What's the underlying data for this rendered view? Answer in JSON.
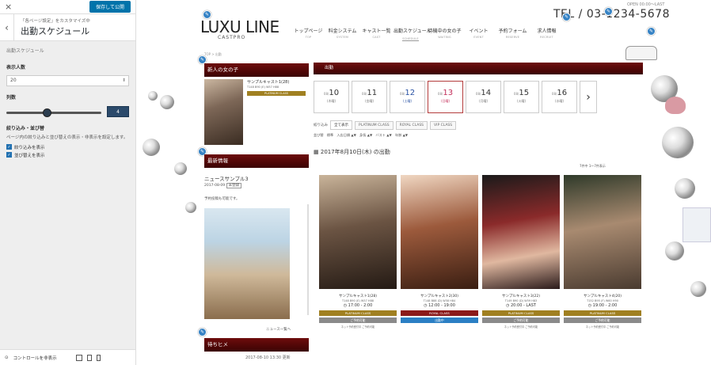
{
  "customizer": {
    "close": "×",
    "publish": "保存して公開",
    "back": "‹",
    "subtitle": "「各ページ設定」をカスタマイズ中",
    "title": "出勤スケジュール",
    "section_label": "出勤スケジュール",
    "count_label": "表示人数",
    "count_value": "20",
    "cols_label": "列数",
    "cols_value": "4",
    "filter_label": "絞り込み・並び替",
    "filter_desc": "ページ内の絞り込みと並び替えの表示・非表示を設定します。",
    "check1": "絞り込みを表示",
    "check2": "並び替えを表示",
    "footer": "コントロールを非表示"
  },
  "site": {
    "logo": "LUXU LINE",
    "logo_sub": "CASTPRO",
    "tel": "TEL / 03-1234-5678",
    "tel_small": "OPEN 00:00〜LAST",
    "nav": [
      {
        "jp": "トップページ",
        "en": "TOP"
      },
      {
        "jp": "料金システム",
        "en": "SYSTEM"
      },
      {
        "jp": "キャスト一覧",
        "en": "CAST"
      },
      {
        "jp": "出勤スケジュール",
        "en": "SCHEDULE"
      },
      {
        "jp": "待機中の女の子",
        "en": "WAITING"
      },
      {
        "jp": "イベント",
        "en": "EVENT"
      },
      {
        "jp": "予約フォーム",
        "en": "RESERVE"
      },
      {
        "jp": "求人情報",
        "en": "RECRUIT"
      }
    ],
    "breadcrumb": "TOP > 出勤",
    "newgirl_head": "新人の女の子",
    "newgirl_name": "サンプルキャスト1(28)",
    "newgirl_spec": "T148 B90 (E) W57 H88",
    "newgirl_badge": "PLATINUM CLASS",
    "news_head": "最新情報",
    "news_title": "ニュースサンプル3",
    "news_date": "2017-08-09",
    "news_tag": "未登録",
    "news_text": "予約投稿も可能です。",
    "news_more": "ニュース一覧へ",
    "diary_head": "待ちヒメ",
    "diary_date": "2017-08-10 13:30 更新"
  },
  "schedule": {
    "head": "出勤",
    "days": [
      {
        "m": "08/",
        "d": "10",
        "w": "(木曜)",
        "today": false
      },
      {
        "m": "08/",
        "d": "11",
        "w": "(金曜)",
        "today": false
      },
      {
        "m": "08/",
        "d": "12",
        "w": "(土曜)",
        "today": false
      },
      {
        "m": "08/",
        "d": "13",
        "w": "(日曜)",
        "today": true
      },
      {
        "m": "08/",
        "d": "14",
        "w": "(月曜)",
        "today": false
      },
      {
        "m": "08/",
        "d": "15",
        "w": "(火曜)",
        "today": false
      },
      {
        "m": "08/",
        "d": "16",
        "w": "(水曜)",
        "today": false
      }
    ],
    "next": "›",
    "filter_label": "絞り込み",
    "filters": [
      "全て表示",
      "PLATINUM CLASS",
      "ROYAL CLASS",
      "VIP CLASS"
    ],
    "sort_text": "並び替　標準　入店日順 ▲▼　身長 ▲▼　バスト ▲▼　年齢 ▲▼",
    "date": "2017年8月10日(木) の出勤",
    "count": "7件中 1〜7件表示",
    "cards": [
      {
        "name": "サンプルキャスト1(28)",
        "spec": "T148 B90 (E) W57 H88",
        "time": "17:00 - 2:00",
        "cls": "PLATINUM CLASS",
        "cls_color": "#a08021",
        "res": "ご予約可能",
        "note": "ネット予約受付中 ご予約可能"
      },
      {
        "name": "サンプルキャスト2(30)",
        "spec": "T148 B88 (D) W58 H84",
        "time": "12:00 - 19:00",
        "cls": "ROYAL CLASS",
        "cls_color": "#8b1a1a",
        "res": "出勤中",
        "note": ""
      },
      {
        "name": "サンプルキャスト3(22)",
        "spec": "T149 B90 (D) W59 H83",
        "time": "20:00 - LAST",
        "cls": "PLATINUM CLASS",
        "cls_color": "#a08021",
        "res": "ご予約可能",
        "note": "ネット予約受付中 ご予約可能"
      },
      {
        "name": "サンプルキャスト4(20)",
        "spec": "T152 B95 (F) W60 H90",
        "time": "19:00 - 2:00",
        "cls": "PLATINUM CLASS",
        "cls_color": "#a08021",
        "res": "ご予約可能",
        "note": "ネット予約受付中 ご予約可能"
      }
    ]
  }
}
